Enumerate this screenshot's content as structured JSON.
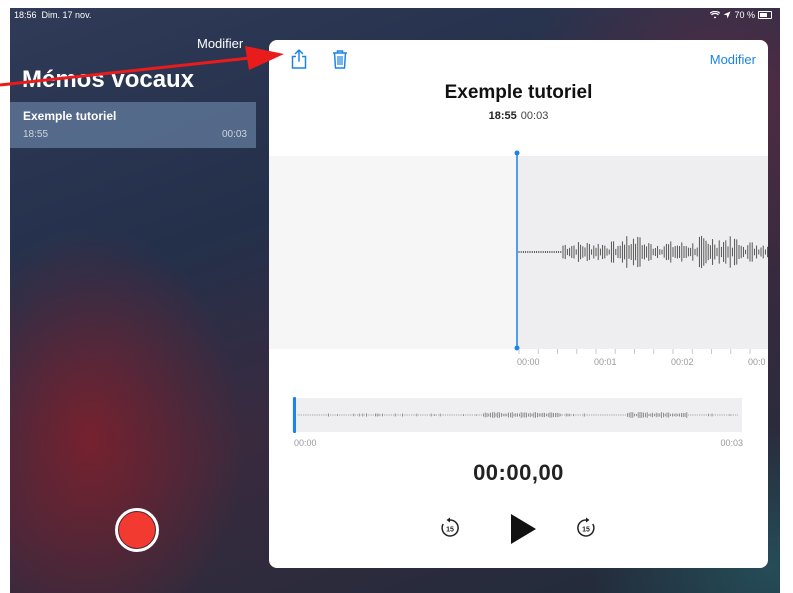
{
  "status_bar": {
    "time": "18:56",
    "date": "Dim. 17 nov.",
    "battery": "70 %"
  },
  "sidebar": {
    "edit_label": "Modifier",
    "title": "Mémos vocaux",
    "items": [
      {
        "name": "Exemple tutoriel",
        "time": "18:55",
        "duration": "00:03"
      }
    ]
  },
  "panel": {
    "edit_label": "Modifier",
    "title": "Exemple tutoriel",
    "time": "18:55",
    "duration": "00:03",
    "timeline_labels": [
      "00:00",
      "00:01",
      "00:02",
      "00:0"
    ],
    "overview_start": "00:00",
    "overview_end": "00:03",
    "counter": "00:00,00",
    "skip_back_label": "15",
    "skip_forward_label": "15"
  },
  "icons": {
    "share": "share-icon",
    "trash": "trash-icon",
    "record": "record-icon",
    "play": "play-icon",
    "skip_back": "skip-back-15-icon",
    "skip_forward": "skip-forward-15-icon"
  },
  "colors": {
    "accent": "#1b84e6",
    "record": "#f23a30",
    "annotation_arrow": "#ea1b1b"
  }
}
